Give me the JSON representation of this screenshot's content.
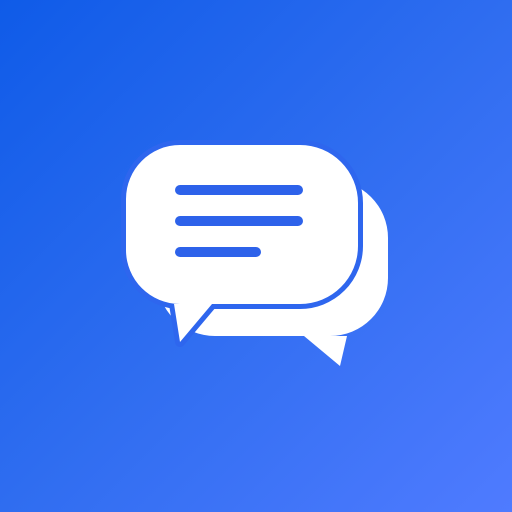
{
  "icon": {
    "name": "chat-bubbles-icon",
    "colors": {
      "background_start": "#0f5be8",
      "background_end": "#4f7bff",
      "bubble_fill": "#ffffff",
      "text_lines": "#2d62ea",
      "bubble_outline": "#2e66ee"
    }
  }
}
